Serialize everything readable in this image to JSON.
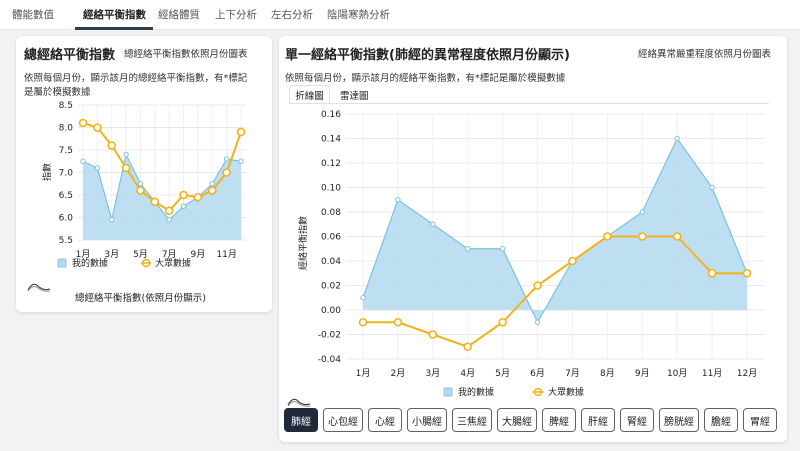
{
  "tabs": [
    {
      "label": "體能數值"
    },
    {
      "label": "經絡平衡指數"
    },
    {
      "label": "經絡體質"
    },
    {
      "label": "上下分析"
    },
    {
      "label": "左右分析"
    },
    {
      "label": "陰陽寒熱分析"
    }
  ],
  "left_card": {
    "title": "總經絡平衡指數",
    "subtitle": "總經絡平衡指數依照月份圖表",
    "description_line1": "依照每個月份，顯示該月的總經絡平衡指數，有*標記",
    "description_line2": "是屬於模擬數據",
    "footer": "總經絡平衡指數(依照月份顯示)",
    "area_icon": "area-chart-icon"
  },
  "right_card": {
    "title": "單一經絡平衡指數(肺經的異常程度依照月份顯示)",
    "subtitle": "經絡異常嚴重程度依照月份圖表",
    "description": "依照每個月份，顯示該月的經絡平衡指數，有*標記是屬於模擬數據",
    "chart_tabs": [
      {
        "label": "折線圖"
      },
      {
        "label": "雷達圖"
      }
    ],
    "area_icon": "area-chart-icon",
    "meridian_buttons": [
      {
        "label": "肺經"
      },
      {
        "label": "心包經"
      },
      {
        "label": "心經"
      },
      {
        "label": "小腸經"
      },
      {
        "label": "三焦經"
      },
      {
        "label": "大腸經"
      },
      {
        "label": "脾經"
      },
      {
        "label": "肝經"
      },
      {
        "label": "腎經"
      },
      {
        "label": "膀胱經"
      },
      {
        "label": "膽經"
      },
      {
        "label": "胃經"
      }
    ]
  },
  "colors": {
    "mine_line": "#7cc0e4",
    "mine_fill": "#b3d9ef",
    "crowd_line": "#f2b21a",
    "active_tab": "#2f3d4f",
    "active_button": "#1e2a3a"
  },
  "chart_data": [
    {
      "type": "area",
      "ylabel": "指數",
      "ylim": [
        5.5,
        8.5
      ],
      "yticks": [
        5.5,
        6.0,
        6.5,
        7.0,
        7.5,
        8.0,
        8.5
      ],
      "x": [
        1,
        2,
        3,
        4,
        5,
        6,
        7,
        8,
        9,
        10,
        11,
        12
      ],
      "xticks": [
        "1月",
        "3月",
        "5月",
        "7月",
        "9月",
        "11月"
      ],
      "grid": true,
      "legend": "bottom",
      "series": [
        {
          "name": "我的數據",
          "values": [
            7.25,
            7.1,
            5.95,
            7.4,
            6.75,
            6.35,
            5.95,
            6.25,
            6.45,
            6.75,
            7.3,
            7.25
          ]
        },
        {
          "name": "大眾數據",
          "values": [
            8.1,
            8.0,
            7.6,
            7.1,
            6.6,
            6.35,
            6.15,
            6.5,
            6.45,
            6.6,
            7.0,
            7.9
          ]
        }
      ]
    },
    {
      "type": "area",
      "ylabel": "經絡平衡指數",
      "ylim": [
        -0.04,
        0.16
      ],
      "yticks": [
        -0.04,
        -0.02,
        0,
        0.02,
        0.04,
        0.06,
        0.08,
        0.1,
        0.12,
        0.14,
        0.16
      ],
      "categories": [
        "1月",
        "2月",
        "3月",
        "4月",
        "5月",
        "6月",
        "7月",
        "8月",
        "9月",
        "10月",
        "11月",
        "12月"
      ],
      "grid": true,
      "legend": "bottom",
      "series": [
        {
          "name": "我的數據",
          "values": [
            0.01,
            0.09,
            0.07,
            0.05,
            0.05,
            -0.01,
            0.04,
            0.06,
            0.08,
            0.14,
            0.1,
            0.03
          ]
        },
        {
          "name": "大眾數據",
          "values": [
            -0.01,
            -0.01,
            -0.02,
            -0.03,
            -0.01,
            0.02,
            0.04,
            0.06,
            0.06,
            0.06,
            0.03,
            0.03
          ]
        }
      ]
    }
  ]
}
